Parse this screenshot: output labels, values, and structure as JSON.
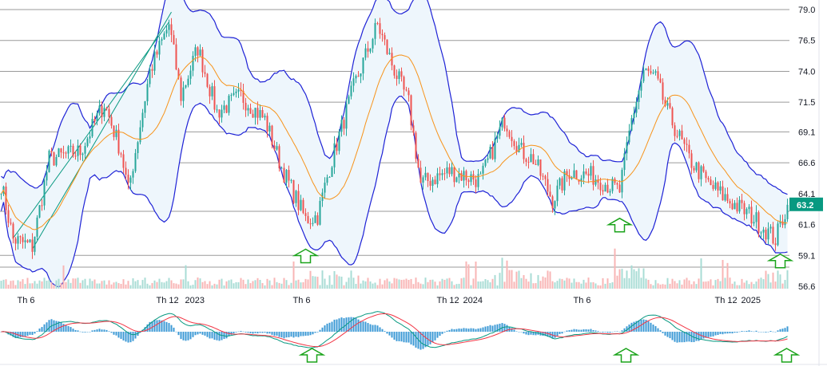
{
  "chart_data": {
    "type": "candlestick",
    "title": "",
    "y_axis": {
      "range": [
        56.6,
        79.0
      ],
      "ticks": [
        "79.0",
        "76.5",
        "74.0",
        "71.5",
        "69.1",
        "66.6",
        "64.1",
        "61.6",
        "59.1",
        "56.6"
      ]
    },
    "x_axis": {
      "ticks": [
        {
          "label": "Th 6",
          "t": 6
        },
        {
          "label": "Th 12",
          "t": 64
        },
        {
          "label": "2023",
          "t": 76
        },
        {
          "label": "Th 6",
          "t": 121
        },
        {
          "label": "Th 12",
          "t": 181
        },
        {
          "label": "2024",
          "t": 192
        },
        {
          "label": "Th 6",
          "t": 238
        },
        {
          "label": "Th 12",
          "t": 297
        },
        {
          "label": "2025",
          "t": 308
        }
      ]
    },
    "last_price": "63.2",
    "price_path": [
      [
        0,
        64.9
      ],
      [
        5,
        60.4
      ],
      [
        13,
        59.8
      ],
      [
        20,
        66.9
      ],
      [
        33,
        67.5
      ],
      [
        43,
        71.4
      ],
      [
        50,
        67.5
      ],
      [
        53,
        64.3
      ],
      [
        62,
        74.0
      ],
      [
        70,
        77.8
      ],
      [
        75,
        72.0
      ],
      [
        82,
        75.9
      ],
      [
        90,
        70.7
      ],
      [
        100,
        72.0
      ],
      [
        110,
        70.1
      ],
      [
        117,
        66.2
      ],
      [
        127,
        62.0
      ],
      [
        132,
        62.3
      ],
      [
        137,
        66.2
      ],
      [
        147,
        72.7
      ],
      [
        157,
        77.8
      ],
      [
        163,
        74.6
      ],
      [
        170,
        71.4
      ],
      [
        175,
        64.9
      ],
      [
        187,
        65.9
      ],
      [
        200,
        65.2
      ],
      [
        210,
        70.1
      ],
      [
        217,
        67.5
      ],
      [
        222,
        66.9
      ],
      [
        230,
        63.6
      ],
      [
        237,
        65.9
      ],
      [
        247,
        65.5
      ],
      [
        258,
        64.3
      ],
      [
        263,
        70.1
      ],
      [
        268,
        74.0
      ],
      [
        273,
        73.4
      ],
      [
        278,
        70.7
      ],
      [
        287,
        66.9
      ],
      [
        295,
        64.9
      ],
      [
        303,
        63.6
      ],
      [
        313,
        62.3
      ],
      [
        323,
        60.4
      ],
      [
        328,
        63.2
      ]
    ],
    "indicators": [
      "Bollinger Bands (20, 2)",
      "SMA 20",
      "Volume",
      "MACD (12, 26, 9)"
    ],
    "signals": [
      {
        "type": "buy-arrow",
        "t": 127,
        "price": 59.6
      },
      {
        "type": "buy-arrow",
        "t": 258,
        "price": 62.1
      },
      {
        "type": "buy-arrow",
        "t": 325,
        "price": 59.2
      }
    ],
    "colors": {
      "up": "#26a69a",
      "down": "#ef5350",
      "band": "#1e22d6",
      "band_fill": "#eef6fc",
      "sma": "#f7931a",
      "arrow": "#1aa31a",
      "price_tag": "#089981",
      "macd": "#089981",
      "signal": "#f23645",
      "hist": "#3c9ad6"
    }
  }
}
